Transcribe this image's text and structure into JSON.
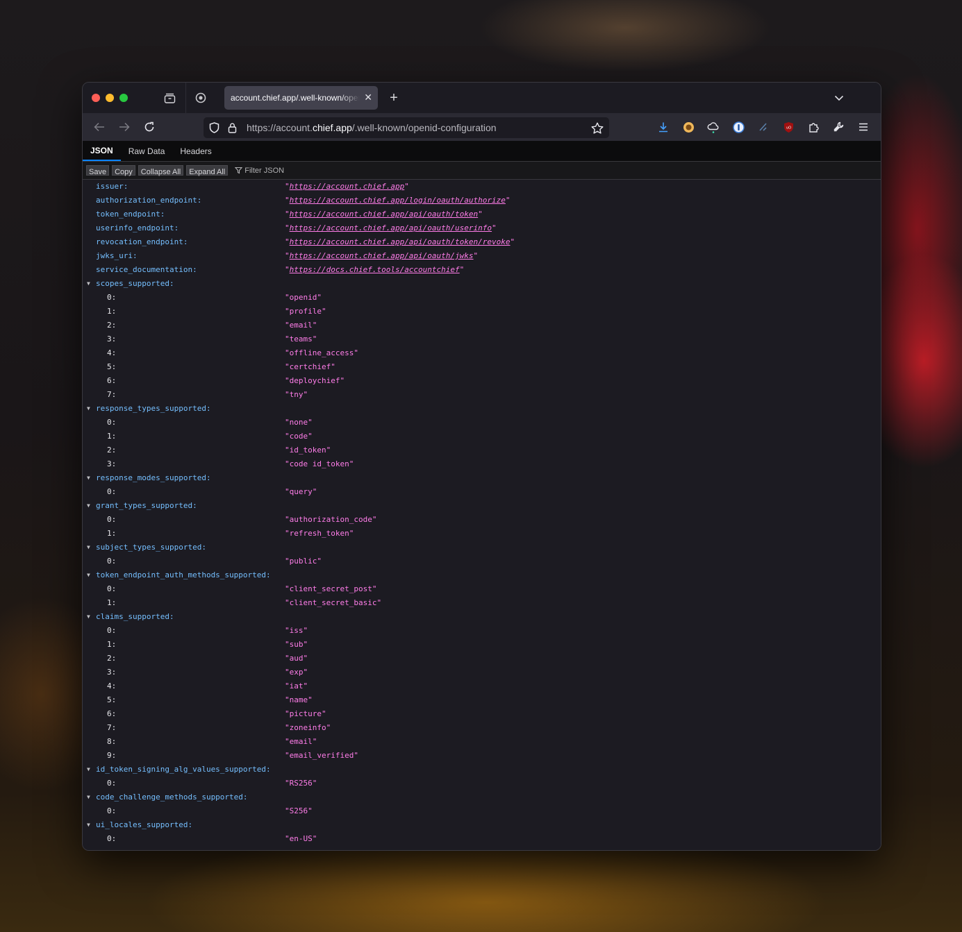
{
  "browser": {
    "tab_title": "account.chief.app/.well-known/openid-configuration",
    "url_prefix": "https://account.",
    "url_domain": "chief.app",
    "url_suffix": "/.well-known/openid-configuration",
    "new_tab": "+"
  },
  "viewer": {
    "tabs": [
      "JSON",
      "Raw Data",
      "Headers"
    ],
    "buttons": [
      "Save",
      "Copy",
      "Collapse All",
      "Expand All"
    ],
    "filter_placeholder": "Filter JSON"
  },
  "rows": [
    {
      "key": "issuer:",
      "value": "https://account.chief.app",
      "link": true
    },
    {
      "key": "authorization_endpoint:",
      "value": "https://account.chief.app/login/oauth/authorize",
      "link": true
    },
    {
      "key": "token_endpoint:",
      "value": "https://account.chief.app/api/oauth/token",
      "link": true
    },
    {
      "key": "userinfo_endpoint:",
      "value": "https://account.chief.app/api/oauth/userinfo",
      "link": true
    },
    {
      "key": "revocation_endpoint:",
      "value": "https://account.chief.app/api/oauth/token/revoke",
      "link": true
    },
    {
      "key": "jwks_uri:",
      "value": "https://account.chief.app/api/oauth/jwks",
      "link": true
    },
    {
      "key": "service_documentation:",
      "value": "https://docs.chief.tools/accountchief",
      "link": true
    },
    {
      "key": "scopes_supported:",
      "group": true
    },
    {
      "key": "0:",
      "value": "openid",
      "child": true
    },
    {
      "key": "1:",
      "value": "profile",
      "child": true
    },
    {
      "key": "2:",
      "value": "email",
      "child": true
    },
    {
      "key": "3:",
      "value": "teams",
      "child": true
    },
    {
      "key": "4:",
      "value": "offline_access",
      "child": true
    },
    {
      "key": "5:",
      "value": "certchief",
      "child": true
    },
    {
      "key": "6:",
      "value": "deploychief",
      "child": true
    },
    {
      "key": "7:",
      "value": "tny",
      "child": true
    },
    {
      "key": "response_types_supported:",
      "group": true
    },
    {
      "key": "0:",
      "value": "none",
      "child": true
    },
    {
      "key": "1:",
      "value": "code",
      "child": true
    },
    {
      "key": "2:",
      "value": "id_token",
      "child": true
    },
    {
      "key": "3:",
      "value": "code id_token",
      "child": true
    },
    {
      "key": "response_modes_supported:",
      "group": true
    },
    {
      "key": "0:",
      "value": "query",
      "child": true
    },
    {
      "key": "grant_types_supported:",
      "group": true
    },
    {
      "key": "0:",
      "value": "authorization_code",
      "child": true
    },
    {
      "key": "1:",
      "value": "refresh_token",
      "child": true
    },
    {
      "key": "subject_types_supported:",
      "group": true
    },
    {
      "key": "0:",
      "value": "public",
      "child": true
    },
    {
      "key": "token_endpoint_auth_methods_supported:",
      "group": true
    },
    {
      "key": "0:",
      "value": "client_secret_post",
      "child": true
    },
    {
      "key": "1:",
      "value": "client_secret_basic",
      "child": true
    },
    {
      "key": "claims_supported:",
      "group": true
    },
    {
      "key": "0:",
      "value": "iss",
      "child": true
    },
    {
      "key": "1:",
      "value": "sub",
      "child": true
    },
    {
      "key": "2:",
      "value": "aud",
      "child": true
    },
    {
      "key": "3:",
      "value": "exp",
      "child": true
    },
    {
      "key": "4:",
      "value": "iat",
      "child": true
    },
    {
      "key": "5:",
      "value": "name",
      "child": true
    },
    {
      "key": "6:",
      "value": "picture",
      "child": true
    },
    {
      "key": "7:",
      "value": "zoneinfo",
      "child": true
    },
    {
      "key": "8:",
      "value": "email",
      "child": true
    },
    {
      "key": "9:",
      "value": "email_verified",
      "child": true
    },
    {
      "key": "id_token_signing_alg_values_supported:",
      "group": true
    },
    {
      "key": "0:",
      "value": "RS256",
      "child": true
    },
    {
      "key": "code_challenge_methods_supported:",
      "group": true
    },
    {
      "key": "0:",
      "value": "S256",
      "child": true
    },
    {
      "key": "ui_locales_supported:",
      "group": true
    },
    {
      "key": "0:",
      "value": "en-US",
      "child": true
    }
  ],
  "colors": {
    "key": "#75bfff",
    "string": "#ff7de9",
    "accent": "#0a84ff"
  }
}
